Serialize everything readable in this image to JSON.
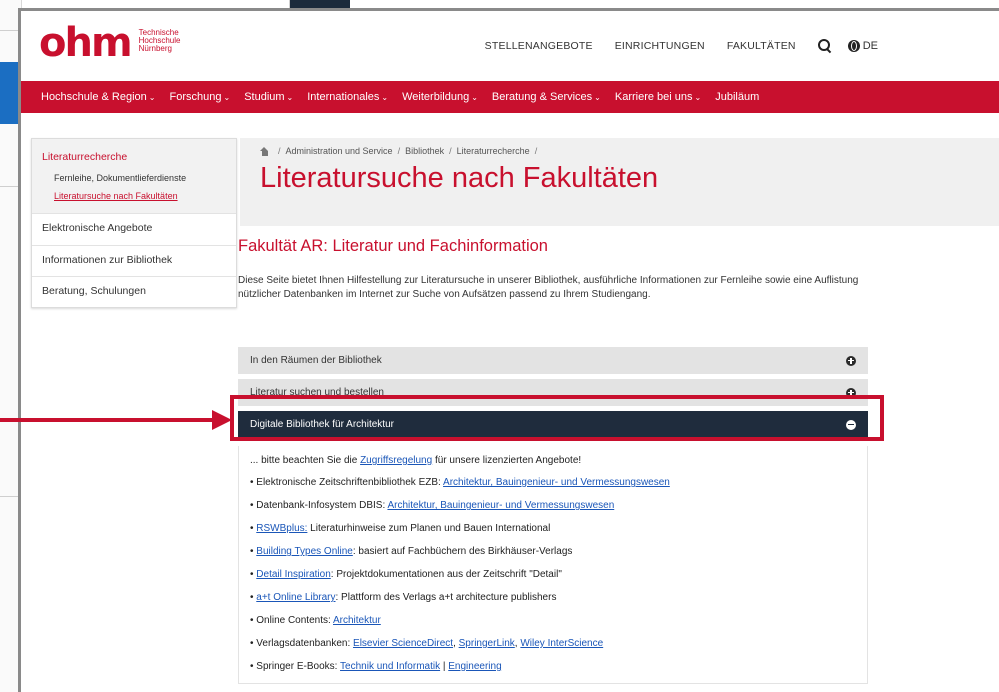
{
  "logo": {
    "word": "ohm",
    "sub1": "Technische",
    "sub2": "Hochschule",
    "sub3": "Nürnberg"
  },
  "top_nav": {
    "items": [
      "STELLENANGEBOTE",
      "EINRICHTUNGEN",
      "FAKULTÄTEN"
    ],
    "lang": "DE"
  },
  "main_nav": {
    "items": [
      "Hochschule & Region",
      "Forschung",
      "Studium",
      "Internationales",
      "Weiterbildung",
      "Beratung & Services",
      "Karriere bei uns",
      "Jubiläum"
    ],
    "chevron": "⌄"
  },
  "sidebar": {
    "active": "Literaturrecherche",
    "subitems": [
      "Fernleihe, Dokumentlieferdienste",
      "Literatursuche nach Fakultäten"
    ],
    "items": [
      "Elektronische Angebote",
      "Informationen zur Bibliothek",
      "Beratung, Schulungen"
    ]
  },
  "breadcrumb": [
    "Administration und Service",
    "Bibliothek",
    "Literaturrecherche"
  ],
  "page_title": "Literatursuche nach Fakultäten",
  "section": {
    "title": "Fakultät AR: Literatur und Fachinformation",
    "text": "Diese Seite bietet Ihnen Hilfestellung zur Literatursuche in unserer Bibliothek, ausführliche Informationen zur Fernleihe sowie eine Auflistung nützlicher Datenbanken im Internet zur Suche von Aufsätzen passend zu Ihrem Studiengang."
  },
  "accordion": [
    "In den Räumen der Bibliothek",
    "Literatur suchen und bestellen",
    "Digitale Bibliothek für Architektur"
  ],
  "panel": {
    "note_pre": "... bitte beachten Sie die ",
    "note_link": "Zugriffsregelung",
    "note_post": " für unsere lizenzierten Angebote!",
    "list": [
      {
        "pre": "• Elektronische Zeitschriftenbibliothek EZB: ",
        "link": "Architektur, Bauingenieur- und Vermessungswesen",
        "post": ""
      },
      {
        "pre": "• Datenbank-Infosystem DBIS: ",
        "link": "Architektur, Bauingenieur- und Vermessungswesen",
        "post": ""
      },
      {
        "pre": "• ",
        "link": "RSWBplus:",
        "post": " Literaturhinweise zum Planen und Bauen International"
      },
      {
        "pre": "• ",
        "link": "Building Types Online",
        "post": ": basiert auf Fachbüchern des Birkhäuser-Verlags"
      },
      {
        "pre": "• ",
        "link": "Detail Inspiration",
        "post": ": Projektdokumentationen aus der Zeitschrift \"Detail\""
      },
      {
        "pre": "• ",
        "link": "a+t Online Library",
        "post": ": Plattform des Verlags a+t architecture publishers"
      },
      {
        "pre": "• Online Contents: ",
        "link": "Architektur",
        "post": ""
      }
    ],
    "verlag_pre": "• Verlagsdatenbanken: ",
    "verlag_links": [
      "Elsevier ScienceDirect",
      "SpringerLink",
      "Wiley InterScience"
    ],
    "springer_pre": "• Springer E-Books: ",
    "springer_links": [
      "Technik und Informatik",
      "Engineering"
    ]
  },
  "colors": {
    "brand_red": "#c8102e",
    "dark_navy": "#1f2c3d",
    "link_blue": "#1a56b8"
  }
}
